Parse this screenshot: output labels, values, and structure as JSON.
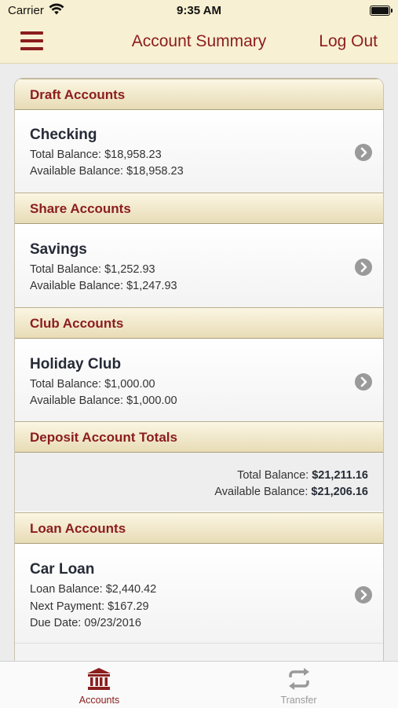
{
  "status": {
    "carrier": "Carrier",
    "time": "9:35 AM"
  },
  "nav": {
    "title": "Account Summary",
    "logout": "Log Out"
  },
  "colors": {
    "accent": "#8b1d1d",
    "header_bg": "#f8f0d2",
    "inactive_tab": "#9a9a9a"
  },
  "sections": {
    "draft": {
      "title": "Draft Accounts"
    },
    "share": {
      "title": "Share Accounts"
    },
    "club": {
      "title": "Club Accounts"
    },
    "totals": {
      "title": "Deposit Account Totals"
    },
    "loan": {
      "title": "Loan Accounts"
    }
  },
  "accounts": {
    "checking": {
      "name": "Checking",
      "line1": "Total Balance: $18,958.23",
      "line2": "Available Balance: $18,958.23"
    },
    "savings": {
      "name": "Savings",
      "line1": "Total Balance: $1,252.93",
      "line2": "Available Balance: $1,247.93"
    },
    "holiday": {
      "name": "Holiday Club",
      "line1": "Total Balance: $1,000.00",
      "line2": "Available Balance: $1,000.00"
    },
    "carloan": {
      "name": "Car Loan",
      "line1": "Loan Balance: $2,440.42",
      "line2": "Next Payment: $167.29",
      "line3": "Due Date: 09/23/2016"
    }
  },
  "totals": {
    "total_label": "Total Balance:",
    "total_value": "$21,211.16",
    "available_label": "Available Balance:",
    "available_value": "$21,206.16"
  },
  "tabs": [
    {
      "label": "Accounts",
      "icon": "bank-icon",
      "active": true
    },
    {
      "label": "Transfer",
      "icon": "transfer-icon",
      "active": false
    }
  ]
}
